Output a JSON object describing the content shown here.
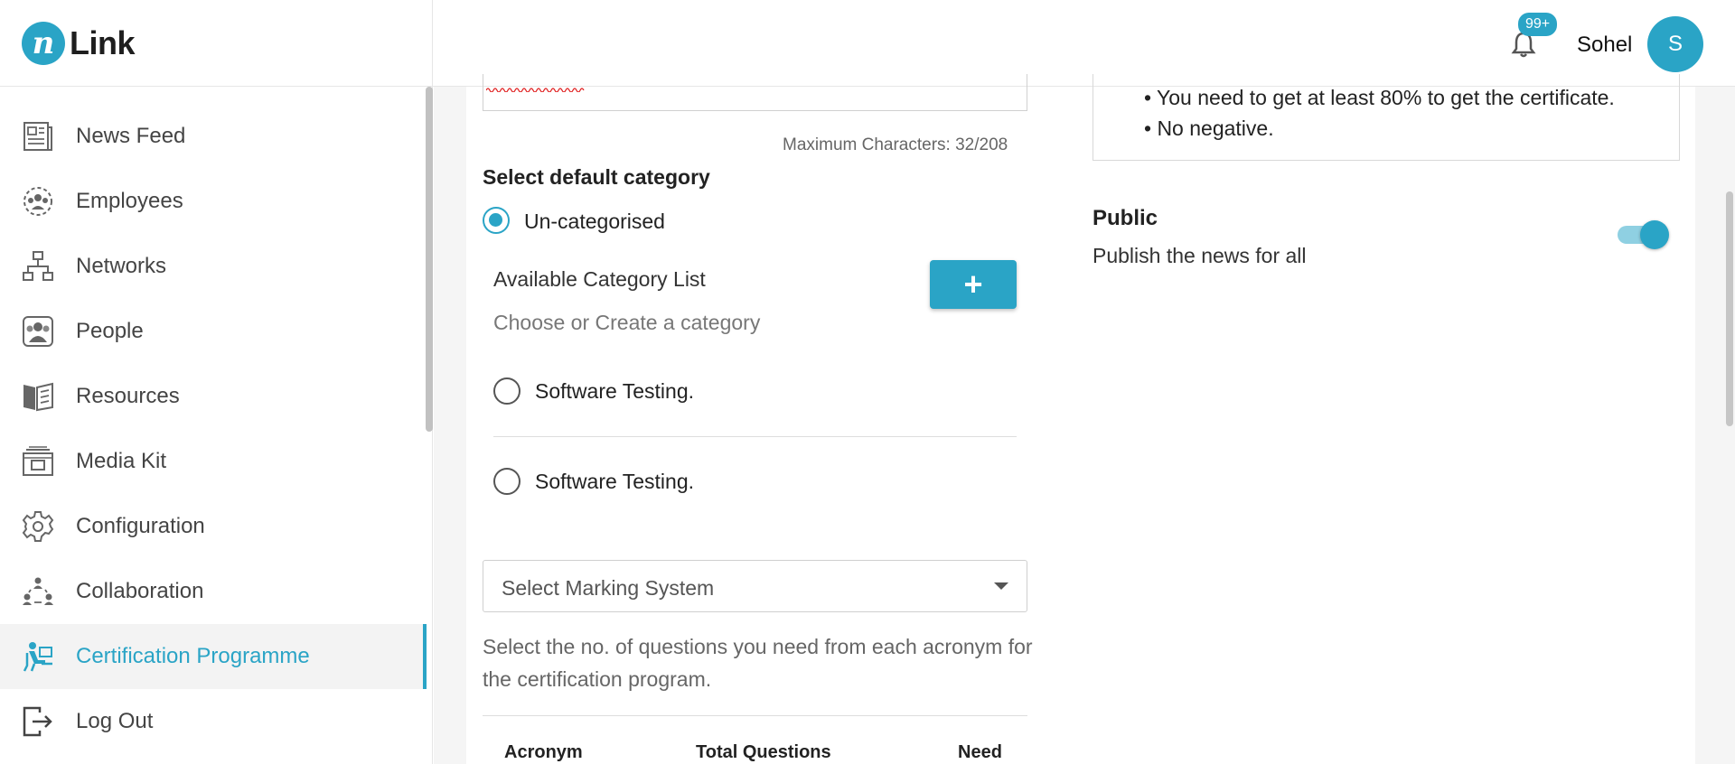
{
  "header": {
    "logo_mark": "n",
    "logo_text": "Link",
    "notification_badge": "99+",
    "user_name": "Sohel",
    "avatar_initial": "S"
  },
  "sidebar": {
    "items": [
      {
        "label": "News Feed",
        "icon": "news-icon"
      },
      {
        "label": "Employees",
        "icon": "employees-icon"
      },
      {
        "label": "Networks",
        "icon": "network-icon"
      },
      {
        "label": "People",
        "icon": "people-icon"
      },
      {
        "label": "Resources",
        "icon": "book-icon"
      },
      {
        "label": "Media Kit",
        "icon": "media-kit-icon"
      },
      {
        "label": "Configuration",
        "icon": "gear-icon"
      },
      {
        "label": "Collaboration",
        "icon": "collaboration-icon"
      },
      {
        "label": "Certification Programme",
        "icon": "certification-icon",
        "active": true
      },
      {
        "label": "Log Out",
        "icon": "logout-icon"
      }
    ]
  },
  "form": {
    "char_count": "Maximum Characters: 32/208",
    "category_title": "Select default category",
    "uncategorised_label": "Un-categorised",
    "available_title": "Available Category List",
    "available_sub": "Choose or Create a category",
    "add_label": "+",
    "categories": [
      {
        "label": "Software Testing."
      },
      {
        "label": "Software Testing."
      }
    ],
    "marking_placeholder": "Select Marking System",
    "helper_text": "Select the no. of questions you need from each acronym for the certification program.",
    "table_headers": [
      "Acronym",
      "Total Questions",
      "Need"
    ]
  },
  "rules": {
    "items": [
      "• You need to get at least 80% to get the certificate.",
      "• No negative."
    ]
  },
  "public": {
    "title": "Public",
    "subtitle": "Publish the news for all",
    "enabled": true
  },
  "colors": {
    "accent": "#2aa4c6",
    "toggle_track": "#8fd0e2"
  }
}
